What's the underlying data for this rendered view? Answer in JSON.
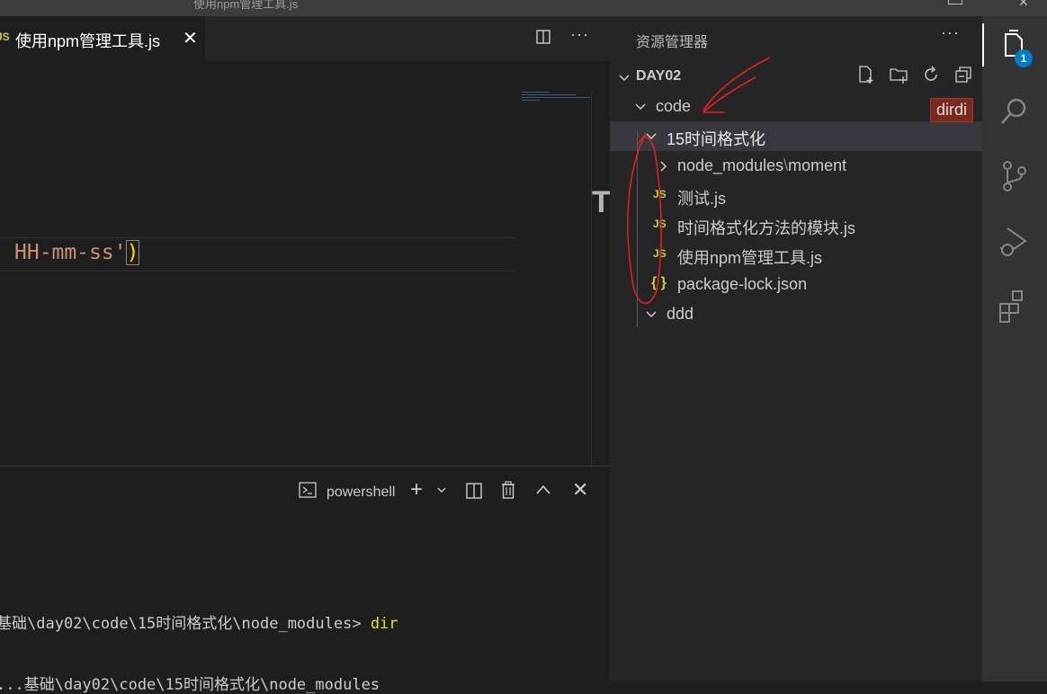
{
  "window": {
    "title_fragment": "使用npm管理工具.js"
  },
  "editor": {
    "tab": {
      "icon": "JS",
      "label": "使用npm管理工具.js",
      "close": "✕"
    },
    "more": "···",
    "code_text": "HH-mm-ss'",
    "code_paren": ")",
    "ghost_char": "T"
  },
  "terminal": {
    "shell_label": "powershell",
    "line1_path": "基础\\day02\\code\\15时间格式化\\node_modules> ",
    "line1_cmd": "dir",
    "line2": "  ...基础\\day02\\code\\15时间格式化\\node_modules"
  },
  "explorer": {
    "title": "资源管理器",
    "more": "···",
    "workspace": "DAY02",
    "tree": [
      {
        "label": "code",
        "type": "folder",
        "expanded": true
      },
      {
        "label": "15时间格式化",
        "type": "folder",
        "expanded": true,
        "selected": true
      },
      {
        "label": "node_modules",
        "sep": "\\",
        "label2": "moment",
        "type": "folder",
        "expanded": false
      },
      {
        "icon": "JS",
        "label": "测试.js",
        "type": "file"
      },
      {
        "icon": "JS",
        "label": "时间格式化方法的模块.js",
        "type": "file"
      },
      {
        "icon": "JS",
        "label": "使用npm管理工具.js",
        "type": "file"
      },
      {
        "icon": "{ }",
        "label": "package-lock.json",
        "type": "file"
      },
      {
        "label": "ddd",
        "type": "folder",
        "expanded": true
      }
    ],
    "rename_hint": "dirdi"
  },
  "activity": {
    "badge": "1",
    "icons": [
      "explorer-icon",
      "search-icon",
      "source-control-icon",
      "run-debug-icon",
      "extensions-icon"
    ]
  },
  "colors": {
    "accent": "#007acc",
    "js_icon": "#cbcb41",
    "string": "#ce9178",
    "annotation": "#e02020"
  }
}
